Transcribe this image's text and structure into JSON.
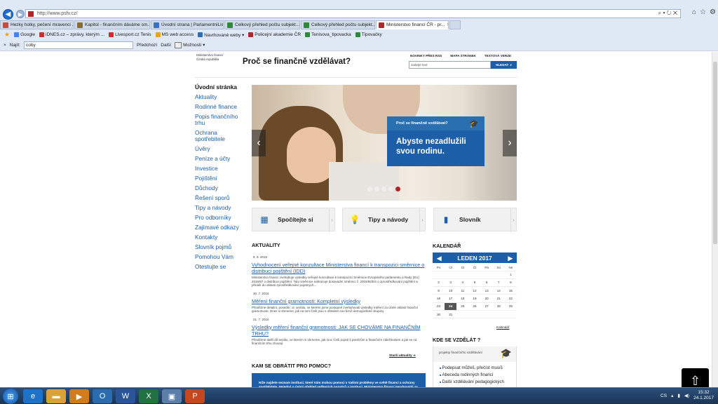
{
  "browser": {
    "url": "http://www.psfv.cz/",
    "tabs": [
      {
        "label": "Hezky holky, pečení mravenci ...",
        "color": "#c94b3a",
        "active": false
      },
      {
        "label": "Kapitol - finančním dáváme sm...",
        "color": "#8a6b2e",
        "active": false
      },
      {
        "label": "Úvodní strana | ParlamentniLis...",
        "color": "#3a72c9",
        "active": false
      },
      {
        "label": "Celkový přehled počtu subjekt...",
        "color": "#2c8a3a",
        "active": false
      },
      {
        "label": "Celkový přehled počtu subjekt...",
        "color": "#2c8a3a",
        "active": false
      },
      {
        "label": "Ministerstvo financí ČR - pr...",
        "color": "#b0262c",
        "active": true
      }
    ],
    "tab_close": "×",
    "favorites": [
      {
        "label": "Google",
        "color": "#4285f4"
      },
      {
        "label": "iDNES.cz – zprávy, kterým ...",
        "color": "#c9302c"
      },
      {
        "label": "Livesport.cz Tenis",
        "color": "#d9272e"
      },
      {
        "label": "MS web access",
        "color": "#e8a317"
      },
      {
        "label": "Navrhované weby ▾",
        "color": "#2a6fb0"
      },
      {
        "label": "Policejní akademie ČR",
        "color": "#b0262c"
      },
      {
        "label": "Tenisova_tipovacka",
        "color": "#2c8a3a"
      },
      {
        "label": "Tipovačky",
        "color": "#2c8a3a"
      }
    ],
    "find": {
      "close": "×",
      "label": "Najít:",
      "value": "coby",
      "prev": "Předchozí",
      "next": "Další",
      "options": "Možnosti"
    }
  },
  "site": {
    "logo_line1": "Ministerstvo financí",
    "logo_line2": "Česká republika",
    "title": "Proč se finančně vzdělávat?",
    "toplinks": [
      "NOVINKY PŘES RSS",
      "MAPA STRÁNEK",
      "TEXTOVÁ VERZE"
    ],
    "search_placeholder": "zadejte text",
    "search_button": "HLEDAT",
    "nav": [
      "Úvodní stránka",
      "Aktuality",
      "Rodinné finance",
      "Popis finančního trhu",
      "Ochrana spotřebitele",
      "Úvěry",
      "Peníze a účty",
      "Investice",
      "Pojištění",
      "Důchody",
      "Řešení sporů",
      "Tipy a návody",
      "Pro odborníky",
      "Zajímavé odkazy",
      "Kontakty",
      "Slovník pojmů",
      "Pomohou Vám",
      "Otestujte se"
    ],
    "hero": {
      "box_title": "Proč se finančně vzdělávat?",
      "box_text": "Abyste nezadlužili svou rodinu.",
      "prev": "‹",
      "next": "›",
      "slides": 5,
      "active_slide": 5
    },
    "tiles": [
      {
        "label": "Spočítejte si",
        "icon": "calculator-icon",
        "color": "#1c5ea8"
      },
      {
        "label": "Tipy a návody",
        "icon": "lightbulb-icon",
        "color": "#c2410c"
      },
      {
        "label": "Slovník",
        "icon": "book-icon",
        "color": "#1c5ea8"
      }
    ],
    "news_heading": "AKTUALITY",
    "news": [
      {
        "date": "8. 9. 2016",
        "title": "Vyhodnocení veřejné konzultace Ministerstva financí k transpozici směrnice o distribuci pojištění (IDD)",
        "text": "Ministerstvo financí zveřejňuje výsledky veřejné konzultace k transpozici Směrnice Evropského parlamentu a Rady (EU) 2016/97 o distribuci pojištění. Tato směrnice nahrazuje dosavadní směrnici č. 2002/92/ES o zprostředkování pojištění a přináší do oblasti zprostředkování pojistných..."
      },
      {
        "date": "30. 7. 2016",
        "title": "Měření finanční gramotnosti: Kompletní výsledky",
        "text": "Přinášíme detailní, posední, ol. seriálu, ve kterém jsme postupně zveřejňovali výsledky měření za účelé oblasti finanční gramotnosti. Dnes si shrneme, jak na tom Češi jsou s ohledem na různé demografické skupiny."
      },
      {
        "date": "21. 7. 2016",
        "title": "Výsledky měření finanční gramotnosti: JAK SE CHOVÁME NA FINANČNÍM TRHU?",
        "text": "Přinášíme další díl seriálu, ve kterém si shrneme, jak moc Češi pojistí k penězům a finančním záležitostem a jak se na finančním trhu chovají."
      }
    ],
    "archive": "Starší aktuality",
    "kam_heading": "KAM SE OBRÁTIT PRO POMOC?",
    "kam_text": "Níže najdete seznam institucí, které Vám mohou pomoci s Vašimi problémy ve světě financí a ochrany spotřebitele. Nejedná o úplný přehled veškerých poradců a institucí. Ministerstvo financí neodpovídá za",
    "calendar": {
      "heading": "KALENDÁŘ",
      "month": "LEDEN 2017",
      "prev": "◀",
      "next": "▶",
      "days": [
        "Po",
        "Út",
        "St",
        "Čt",
        "Pá",
        "So",
        "Ne"
      ],
      "weeks": [
        [
          "",
          "",
          "",
          "",
          "",
          "",
          "1"
        ],
        [
          "2",
          "3",
          "4",
          "5",
          "6",
          "7",
          "8"
        ],
        [
          "9",
          "10",
          "11",
          "12",
          "13",
          "14",
          "15"
        ],
        [
          "16",
          "17",
          "18",
          "19",
          "20",
          "21",
          "22"
        ],
        [
          "23",
          "24",
          "25",
          "26",
          "27",
          "28",
          "29"
        ],
        [
          "30",
          "31",
          "",
          "",
          "",
          "",
          ""
        ]
      ],
      "today": "24",
      "link": "Kalendář"
    },
    "edu": {
      "heading": "KDE SE VZDĚLÁT ?",
      "sub": "projekty finančního vzdělávání",
      "items": [
        "Podepsat můžeš, přečíst musíš",
        "Abeceda rodinných financí",
        "Další vzdělávání pedagogických"
      ]
    }
  },
  "taskbar": {
    "lang": "CS",
    "time": "15:32",
    "date": "24.1.2017",
    "apps": [
      {
        "name": "ie-icon",
        "color": "#1e73c9"
      },
      {
        "name": "folder-icon",
        "color": "#d8a23a"
      },
      {
        "name": "media-player-icon",
        "color": "#d07b1d"
      },
      {
        "name": "outlook-icon",
        "color": "#2b6cb0"
      },
      {
        "name": "word-icon",
        "color": "#2a5699"
      },
      {
        "name": "excel-icon",
        "color": "#207245"
      },
      {
        "name": "network-icon",
        "color": "#5b7fa8"
      },
      {
        "name": "powerpoint-icon",
        "color": "#c4471f"
      }
    ]
  }
}
